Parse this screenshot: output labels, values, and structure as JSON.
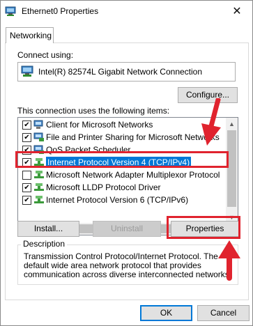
{
  "window": {
    "title": "Ethernet0 Properties",
    "close_glyph": "✕"
  },
  "tabs": [
    {
      "label": "Networking"
    }
  ],
  "connect_using": {
    "label": "Connect using:",
    "adapter": "Intel(R) 82574L Gigabit Network Connection",
    "configure_button": "Configure..."
  },
  "items": {
    "label": "This connection uses the following items:",
    "list": [
      {
        "label": "Client for Microsoft Networks",
        "checked": true,
        "icon": "network-client-icon"
      },
      {
        "label": "File and Printer Sharing for Microsoft Networks",
        "checked": true,
        "icon": "network-service-icon"
      },
      {
        "label": "QoS Packet Scheduler",
        "checked": true,
        "icon": "network-service-icon"
      },
      {
        "label": "Internet Protocol Version 4 (TCP/IPv4)",
        "checked": true,
        "selected": true,
        "icon": "protocol-icon"
      },
      {
        "label": "Microsoft Network Adapter Multiplexor Protocol",
        "checked": false,
        "icon": "protocol-icon"
      },
      {
        "label": "Microsoft LLDP Protocol Driver",
        "checked": true,
        "icon": "protocol-icon"
      },
      {
        "label": "Internet Protocol Version 6 (TCP/IPv6)",
        "checked": true,
        "icon": "protocol-icon"
      }
    ]
  },
  "buttons": {
    "install": "Install...",
    "uninstall": "Uninstall",
    "properties": "Properties",
    "ok": "OK",
    "cancel": "Cancel"
  },
  "description": {
    "label": "Description",
    "text": "Transmission Control Protocol/Internet Protocol. The default wide area network protocol that provides communication across diverse interconnected networks."
  },
  "colors": {
    "selection": "#0078d7",
    "annotation": "#e0232e"
  }
}
